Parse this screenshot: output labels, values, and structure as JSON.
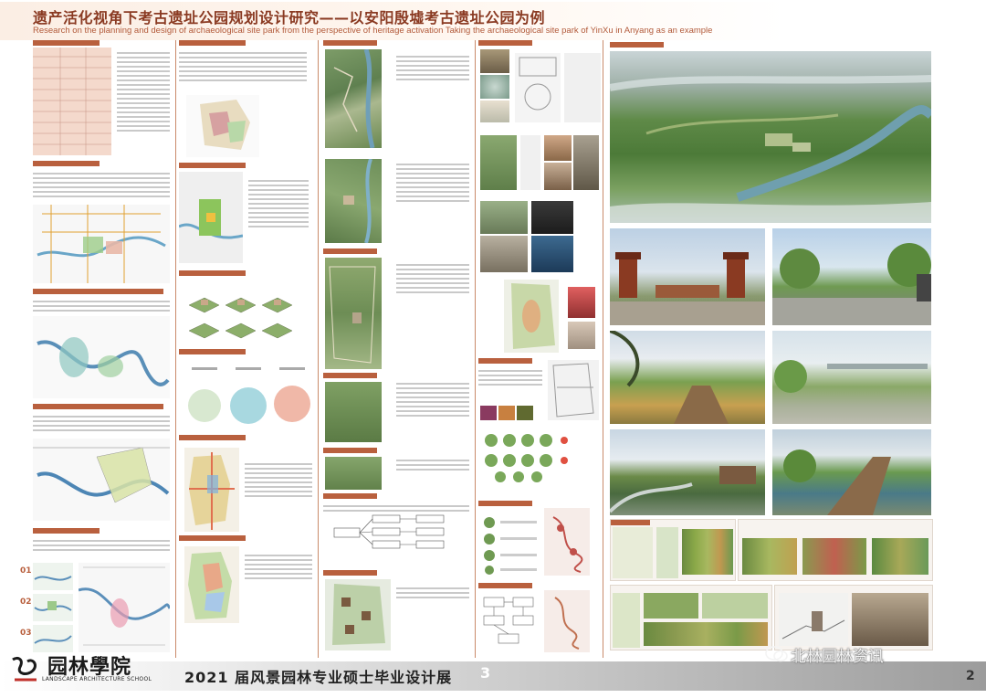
{
  "header": {
    "title_zh": "遗产活化视角下考古遗址公园规划设计研究——以安阳殷墟考古遗址公园为例",
    "title_en": "Research on the planning and design of archaeological site park from the perspective of heritage activation    Taking the archaeological site park of YinXu in Anyang as an  example"
  },
  "footer": {
    "school_logo_zh": "园林學院",
    "school_logo_en": "LANDSCAPE ARCHITECTURE SCHOOL",
    "exhibition_title": "2021 届风景园林专业硕士毕业设计展",
    "exhibition_number": "3",
    "page_number": "2",
    "wechat_account": "北林园林资讯"
  },
  "colors": {
    "accent": "#b9603e",
    "title": "#8a3a22",
    "panel_bg": "#f7f3ef",
    "divider": "#c98a6a"
  },
  "maps": {
    "markers": [
      "01",
      "02",
      "03"
    ]
  }
}
